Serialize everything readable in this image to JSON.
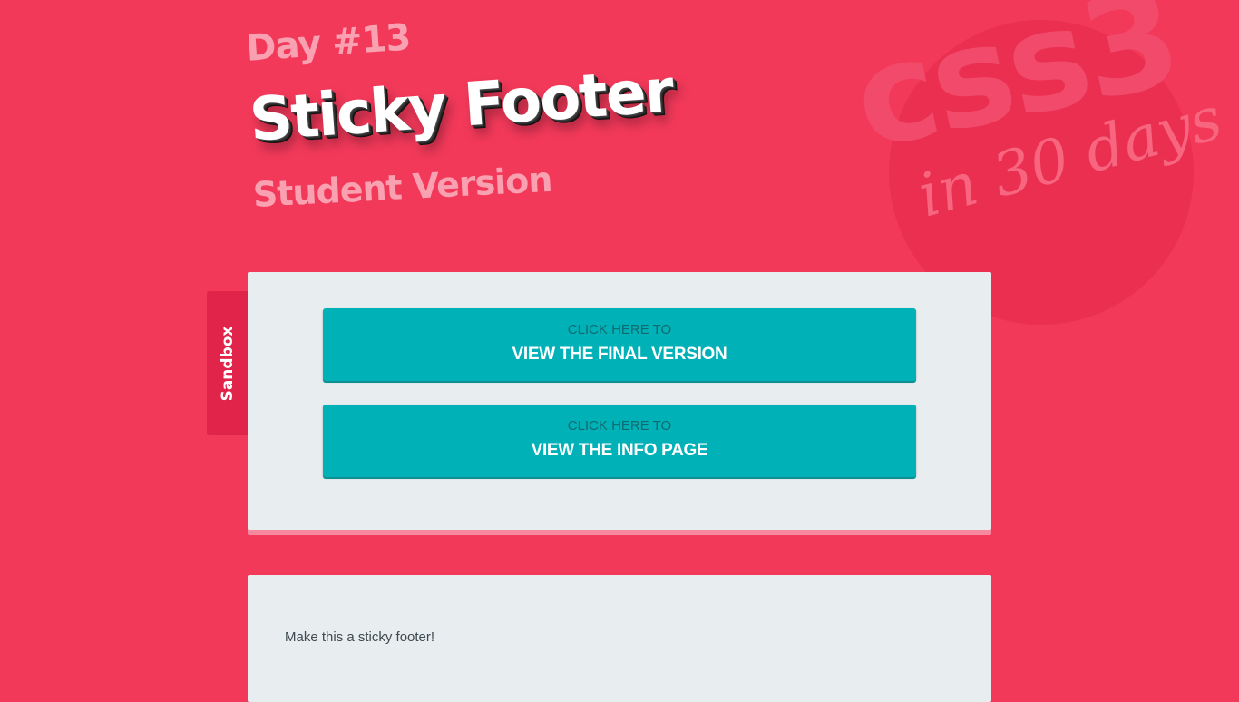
{
  "header": {
    "day": "Day #13",
    "title": "Sticky Footer",
    "subtitle": "Student Version"
  },
  "badge": {
    "big": "css3",
    "small": "in 30 days"
  },
  "sidebar_tab": {
    "label": "Sandbox"
  },
  "links": [
    {
      "kicker": "CLICK HERE TO",
      "label": "VIEW THE FINAL VERSION"
    },
    {
      "kicker": "CLICK HERE TO",
      "label": "VIEW THE INFO PAGE"
    }
  ],
  "footer": {
    "text": "Make this a sticky footer!"
  },
  "colors": {
    "background": "#f2395a",
    "card": "#e8edf0",
    "button": "#00b2b7",
    "tab": "#e0244a"
  }
}
